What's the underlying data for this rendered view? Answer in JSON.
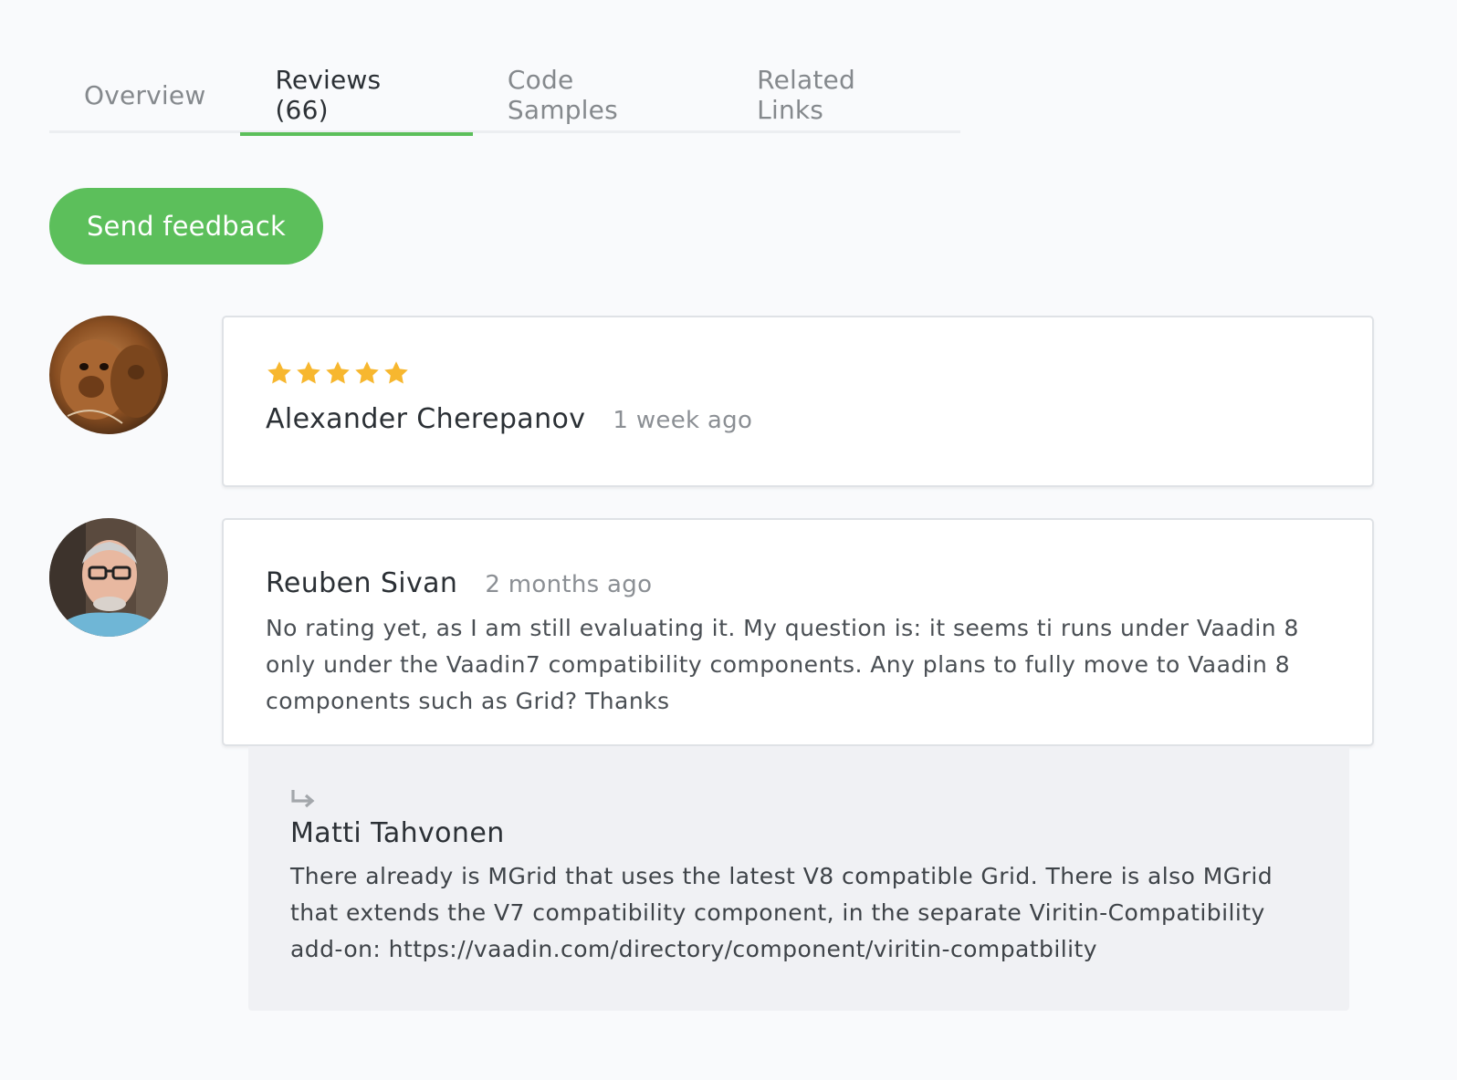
{
  "tabs": [
    {
      "label": "Overview",
      "active": false
    },
    {
      "label": "Reviews (66)",
      "active": true
    },
    {
      "label": "Code Samples",
      "active": false
    },
    {
      "label": "Related Links",
      "active": false
    }
  ],
  "feedback_button": {
    "label": "Send feedback"
  },
  "reviews": [
    {
      "author": "Alexander Cherepanov",
      "date": "1 week ago",
      "rating": 5,
      "text": ""
    },
    {
      "author": "Reuben Sivan",
      "date": "2 months ago",
      "rating": null,
      "text": "No rating yet, as I am still evaluating it. My question is: it seems ti runs under Vaadin 8 only under the Vaadin7 compatibility components. Any plans to fully move to Vaadin 8 components such as Grid? Thanks",
      "reply": {
        "icon": "reply-arrow-icon",
        "author": "Matti Tahvonen",
        "text": "There already is MGrid that uses the latest V8 compatible Grid. There is also MGrid that extends the V7 compatibility component, in the separate Viritin-Compatibility add-on: https://vaadin.com/directory/component/viritin-compatbility"
      }
    }
  ],
  "colors": {
    "accent": "#5cbf5b",
    "star": "#f7b72f",
    "background": "#f9fafc",
    "reply_background": "#f0f1f4"
  }
}
